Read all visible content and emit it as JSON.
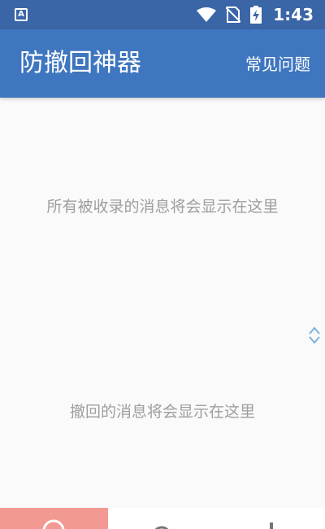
{
  "status_bar": {
    "app_badge": "A",
    "time": "1:43",
    "icons": [
      "wifi-icon",
      "no-sim-icon",
      "battery-charging-icon"
    ]
  },
  "app_bar": {
    "title": "防撤回神器",
    "faq_label": "常见问题"
  },
  "main": {
    "messages_empty_text": "所有被收录的消息将会显示在这里",
    "recalled_empty_text": "撤回的消息将会显示在这里"
  },
  "scroll_toggle": {
    "icons": [
      "chevron-up-icon",
      "chevron-down-icon"
    ],
    "color": "#7fb0d8"
  },
  "bottom_nav": {
    "tabs": [
      {
        "icon": "search-icon",
        "active": true
      },
      {
        "icon": "person-icon",
        "active": false
      },
      {
        "icon": "settings-icon",
        "active": false
      }
    ]
  },
  "colors": {
    "status_bar": "#3a66a8",
    "app_bar": "#3e76bf",
    "background": "#fafafa",
    "empty_text": "#9e9e9e",
    "active_tab": "#f29a91"
  }
}
